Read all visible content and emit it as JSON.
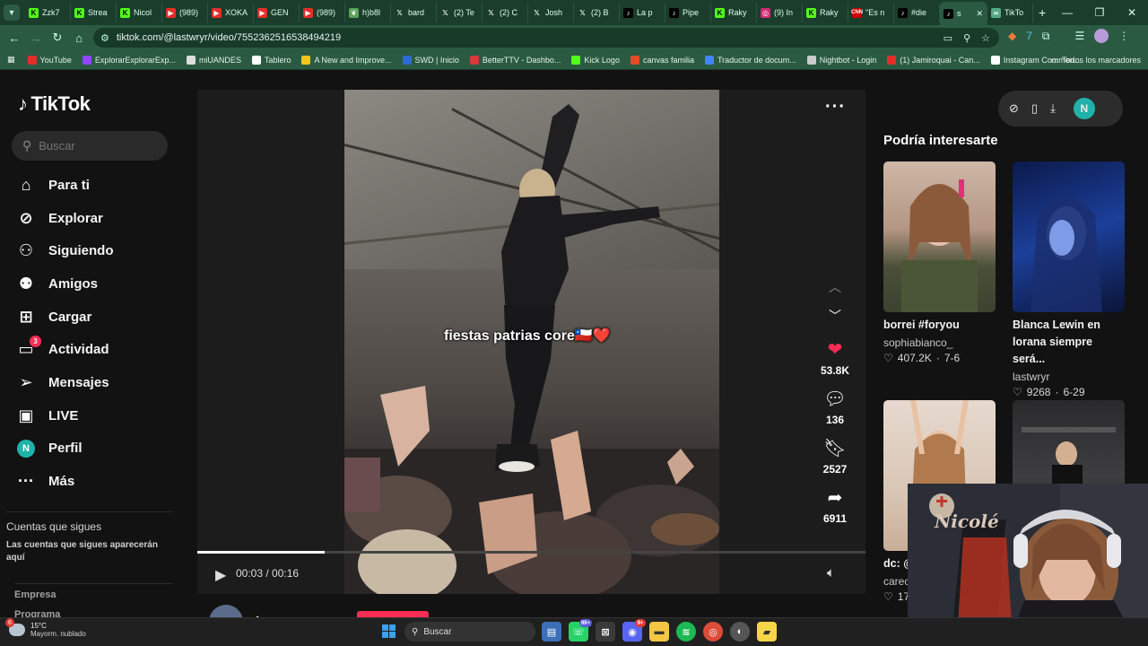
{
  "browser": {
    "tabs": [
      {
        "label": "Zzk7",
        "icon": "kick-favicon-icon"
      },
      {
        "label": "Strea",
        "icon": "kick-favicon-icon"
      },
      {
        "label": "Nicol",
        "icon": "kick-favicon-icon"
      },
      {
        "label": "(989)",
        "icon": "youtube-favicon-icon"
      },
      {
        "label": "XOKA",
        "icon": "youtube-favicon-icon"
      },
      {
        "label": "GEN",
        "icon": "youtube-favicon-icon"
      },
      {
        "label": "(989)",
        "icon": "youtube-favicon-icon"
      },
      {
        "label": "h)b8l",
        "icon": "leaf-favicon-icon"
      },
      {
        "label": "bard",
        "icon": "x-favicon-icon"
      },
      {
        "label": "(2) Te",
        "icon": "x-favicon-icon"
      },
      {
        "label": "(2) C",
        "icon": "x-favicon-icon"
      },
      {
        "label": "Josh",
        "icon": "x-favicon-icon"
      },
      {
        "label": "(2) B",
        "icon": "x-favicon-icon"
      },
      {
        "label": "La p",
        "icon": "tiktok-favicon-icon"
      },
      {
        "label": "Pipe",
        "icon": "tiktok-favicon-icon"
      },
      {
        "label": "Raky",
        "icon": "kick-favicon-icon"
      },
      {
        "label": "(9) In",
        "icon": "instagram-favicon-icon"
      },
      {
        "label": "Raky",
        "icon": "kick-favicon-icon"
      },
      {
        "label": "\"Es n",
        "icon": "cnn-favicon-icon"
      },
      {
        "label": "#die",
        "icon": "tiktok-favicon-icon"
      },
      {
        "label": "s",
        "icon": "tiktok-favicon-icon",
        "active": true
      },
      {
        "label": "TikTo",
        "icon": "link-favicon-icon"
      }
    ],
    "url": "tiktok.com/@lastwryr/video/7552362516538494219",
    "bookmarks": [
      {
        "label": "YouTube",
        "color": "#e52d27"
      },
      {
        "label": "ExplorarExplorarExp...",
        "color": "#9146ff"
      },
      {
        "label": "miUANDES",
        "color": "#dddddd"
      },
      {
        "label": "Tablero",
        "color": "#ffffff"
      },
      {
        "label": "A New and Improve...",
        "color": "#f5c518"
      },
      {
        "label": "SWD | Inicio",
        "color": "#2a6bd6"
      },
      {
        "label": "BetterTTV - Dashbo...",
        "color": "#d63a3a"
      },
      {
        "label": "Kick Logo",
        "color": "#53fc18"
      },
      {
        "label": "canvas familia",
        "color": "#e34c26"
      },
      {
        "label": "Traductor de docum...",
        "color": "#4285f4"
      },
      {
        "label": "Nightbot - Login",
        "color": "#cccccc"
      },
      {
        "label": "(1) Jamiroquai - Can...",
        "color": "#e52d27"
      },
      {
        "label": "Instagram Commen...",
        "color": "#ffffff"
      }
    ],
    "all_bookmarks": "Todos los marcadores"
  },
  "sidebar": {
    "logo": "TikTok",
    "search_placeholder": "Buscar",
    "items": [
      {
        "label": "Para ti",
        "icon": "home-icon"
      },
      {
        "label": "Explorar",
        "icon": "compass-icon"
      },
      {
        "label": "Siguiendo",
        "icon": "following-icon"
      },
      {
        "label": "Amigos",
        "icon": "friends-icon"
      },
      {
        "label": "Cargar",
        "icon": "upload-icon"
      },
      {
        "label": "Actividad",
        "icon": "activity-icon",
        "badge": "3"
      },
      {
        "label": "Mensajes",
        "icon": "messages-icon"
      },
      {
        "label": "LIVE",
        "icon": "live-icon"
      },
      {
        "label": "Perfil",
        "icon": "profile-avatar",
        "avatar": "N"
      },
      {
        "label": "Más",
        "icon": "more-icon"
      }
    ],
    "following_title": "Cuentas que sigues",
    "following_desc": "Las cuentas que sigues aparecerán aquí",
    "footer": [
      "Empresa",
      "Programa"
    ]
  },
  "video": {
    "caption": "fiestas patrias core🇨🇱❤️",
    "time": "00:03 / 00:16",
    "progress": 0.19,
    "author": "lastwryr",
    "actions": {
      "likes": "53.8K",
      "comments": "136",
      "saves": "2527",
      "shares": "6911"
    }
  },
  "right": {
    "avatar": "N",
    "suggestions_title": "Podría interesarte",
    "cards": [
      {
        "title": "borrei #foryou",
        "user": "sophiabianco_",
        "likes": "407.2K",
        "date": "7-6"
      },
      {
        "title": "Blanca Lewin en lorana siempre será...",
        "user": "lastwryr",
        "likes": "9268",
        "date": "6-29"
      },
      {
        "title": "dc: @",
        "user": "carec",
        "likes": "17",
        "date": ""
      },
      {
        "title": "",
        "user": "",
        "likes": "",
        "date": ""
      }
    ]
  },
  "taskbar": {
    "weather_temp": "15°C",
    "weather_desc": "Mayorm. nublado",
    "weather_badge": "6",
    "search_label": "Buscar",
    "whatsapp_badge": "99+",
    "discord_badge": "9+"
  },
  "webcam": {
    "sign": "Nicolé"
  }
}
